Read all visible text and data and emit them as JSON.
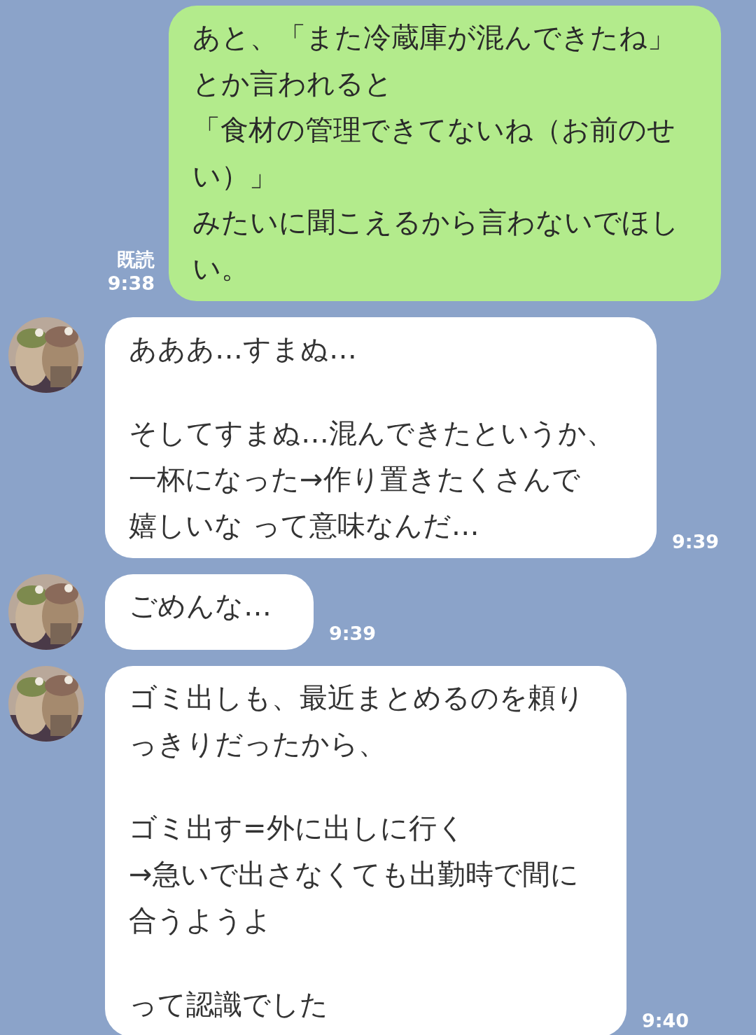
{
  "messages": [
    {
      "kind": "outgoing",
      "paragraphs": [
        [
          "あと、「また冷蔵庫が混んできたね」",
          "とか言われると",
          "「食材の管理できてないね（お前のせ",
          "い）」",
          "みたいに聞こえるから言わないでほし",
          "い。"
        ]
      ],
      "read_label": "既読",
      "time": "9:38"
    },
    {
      "kind": "incoming",
      "paragraphs": [
        [
          "あああ…すまぬ…"
        ],
        [
          "そしてすまぬ…混んできたというか、",
          "一杯になった→作り置きたくさんで",
          "嬉しいな って意味なんだ…"
        ]
      ],
      "time": "9:39"
    },
    {
      "kind": "incoming",
      "paragraphs": [
        [
          "ごめんな…"
        ]
      ],
      "time": "9:39"
    },
    {
      "kind": "incoming",
      "paragraphs": [
        [
          "ゴミ出しも、最近まとめるのを頼り",
          "っきりだったから、"
        ],
        [
          "ゴミ出す=外に出しに行く",
          "→急いで出さなくても出勤時で間に",
          "合うようよ"
        ],
        [
          "って認識でした"
        ]
      ],
      "time": "9:40"
    }
  ]
}
